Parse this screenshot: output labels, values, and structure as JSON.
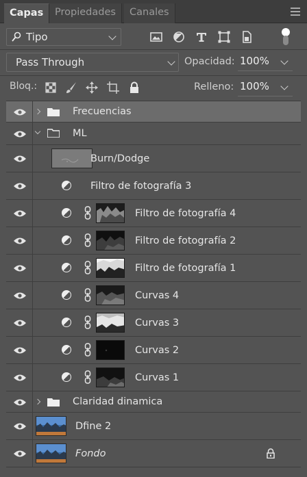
{
  "tabs": [
    {
      "label": "Capas",
      "active": true
    },
    {
      "label": "Propiedades",
      "active": false
    },
    {
      "label": "Canales",
      "active": false
    }
  ],
  "filter": {
    "kind_label": "Tipo",
    "search_icon": "search-icon"
  },
  "filter_icons": [
    "image-filter-icon",
    "adjustment-filter-icon",
    "type-filter-icon",
    "shape-filter-icon",
    "smart-object-filter-icon"
  ],
  "blend": {
    "mode": "Pass Through",
    "opacity_label": "Opacidad:",
    "opacity_value": "100%"
  },
  "lock": {
    "label": "Bloq.:",
    "icons": [
      "lock-transparent-icon",
      "lock-image-icon",
      "lock-position-icon",
      "lock-artboard-icon",
      "lock-all-icon"
    ],
    "fill_label": "Relleno:",
    "fill_value": "100%"
  },
  "layers": [
    {
      "name": "Frecuencias",
      "type": "group",
      "expanded": false,
      "selected": true
    },
    {
      "name": "ML",
      "type": "group",
      "expanded": true
    },
    {
      "name": "Burn/Dodge",
      "type": "pixel"
    },
    {
      "name": "Filtro de fotografía 3",
      "type": "adjustment"
    },
    {
      "name": "Filtro de fotografía 4",
      "type": "adjustment-mask"
    },
    {
      "name": "Filtro de fotografía 2",
      "type": "adjustment-mask"
    },
    {
      "name": "Filtro de fotografía 1",
      "type": "adjustment-mask"
    },
    {
      "name": "Curvas 4",
      "type": "adjustment-mask"
    },
    {
      "name": "Curvas 3",
      "type": "adjustment-mask"
    },
    {
      "name": "Curvas 2",
      "type": "adjustment-mask"
    },
    {
      "name": "Curvas 1",
      "type": "adjustment-mask"
    },
    {
      "name": "Claridad dinamica",
      "type": "group",
      "expanded": false
    },
    {
      "name": "Dfine 2",
      "type": "photo"
    },
    {
      "name": "Fondo",
      "type": "photo",
      "italic": true,
      "locked": true
    }
  ],
  "colors": {
    "panel": "#535353",
    "tabbar": "#3d3d3d",
    "selected_row": "#6c6c6c",
    "text": "#e6e6e6"
  }
}
